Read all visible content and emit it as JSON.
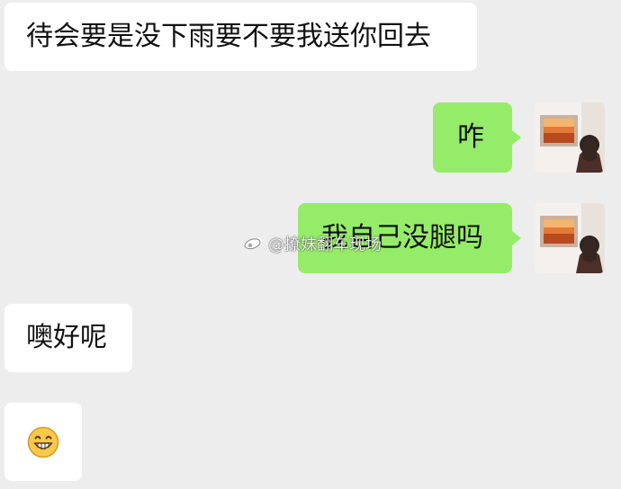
{
  "chat": {
    "messages": [
      {
        "side": "left",
        "text": "待会要是没下雨要不要我送你回去"
      },
      {
        "side": "right",
        "text": "咋"
      },
      {
        "side": "right",
        "text": "我自己没腿吗"
      },
      {
        "side": "left",
        "text": "噢好呢"
      },
      {
        "side": "left",
        "emoji": "grinning-face"
      }
    ]
  },
  "watermark": {
    "text": "@撩妹翻车现场"
  },
  "avatar": {
    "icon": "avatar-woman-looking-at-painting"
  },
  "colors": {
    "background": "#ededed",
    "incoming_bubble": "#ffffff",
    "outgoing_bubble": "#95ec69",
    "text": "#111111"
  }
}
